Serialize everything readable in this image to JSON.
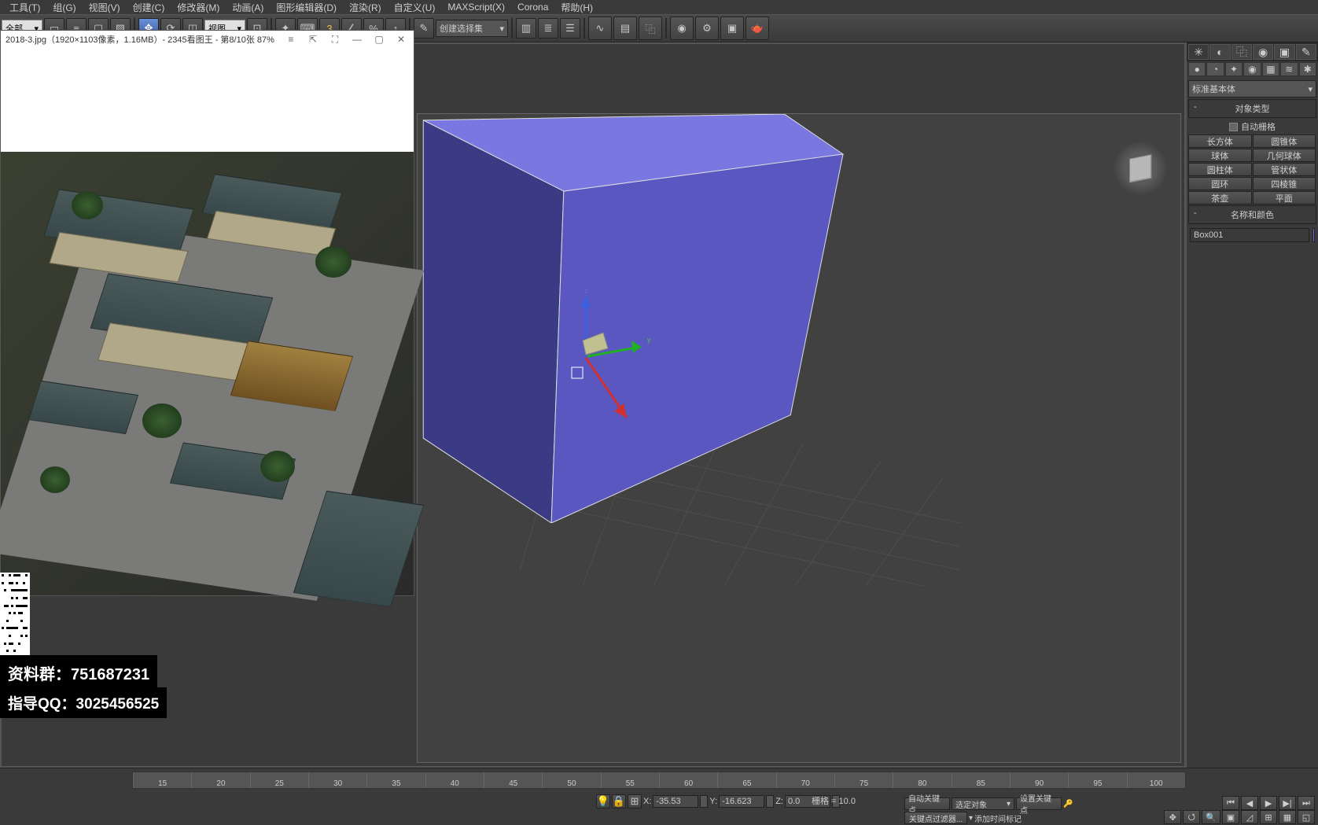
{
  "menu": {
    "items": [
      "工具(T)",
      "组(G)",
      "视图(V)",
      "创建(C)",
      "修改器(M)",
      "动画(A)",
      "图形编辑器(D)",
      "渲染(R)",
      "自定义(U)",
      "MAXScript(X)",
      "Corona",
      "帮助(H)"
    ]
  },
  "toolbar": {
    "filter_dd": "全部",
    "view_dd": "视图",
    "select_set_dd": "创建选择集",
    "num": "3"
  },
  "imgwin": {
    "title": "2018-3.jpg（1920×1103像素，1.16MB）- 2345看图王 - 第8/10张 87%"
  },
  "cmdpanel": {
    "category_dd": "标准基本体",
    "section_obj": "对象类型",
    "chk_autotile": "自动栅格",
    "prims": {
      "p0": "长方体",
      "p1": "圆锥体",
      "p2": "球体",
      "p3": "几何球体",
      "p4": "圆柱体",
      "p5": "管状体",
      "p6": "圆环",
      "p7": "四棱锥",
      "p8": "茶壶",
      "p9": "平面"
    },
    "section_name": "名称和颜色",
    "obj_name": "Box001"
  },
  "timeline": {
    "ticks": [
      "15",
      "20",
      "25",
      "30",
      "35",
      "40",
      "45",
      "50",
      "55",
      "60",
      "65",
      "70",
      "75",
      "80",
      "85",
      "90",
      "95",
      "100"
    ]
  },
  "coords": {
    "xlabel": "X:",
    "xval": "-35.53",
    "ylabel": "Y:",
    "yval": "-16.623",
    "zlabel": "Z:",
    "zval": "0.0"
  },
  "grid": "栅格 = 10.0",
  "status": {
    "autokey": "自动关键点",
    "setkey": "设置关键点",
    "selected_dd": "选定对象",
    "addtime": "添加时间标记",
    "keyfilter": "关键点过滤器..."
  },
  "overlay": {
    "line1": "资料群：751687231",
    "line2": "指导QQ：3025456525"
  }
}
